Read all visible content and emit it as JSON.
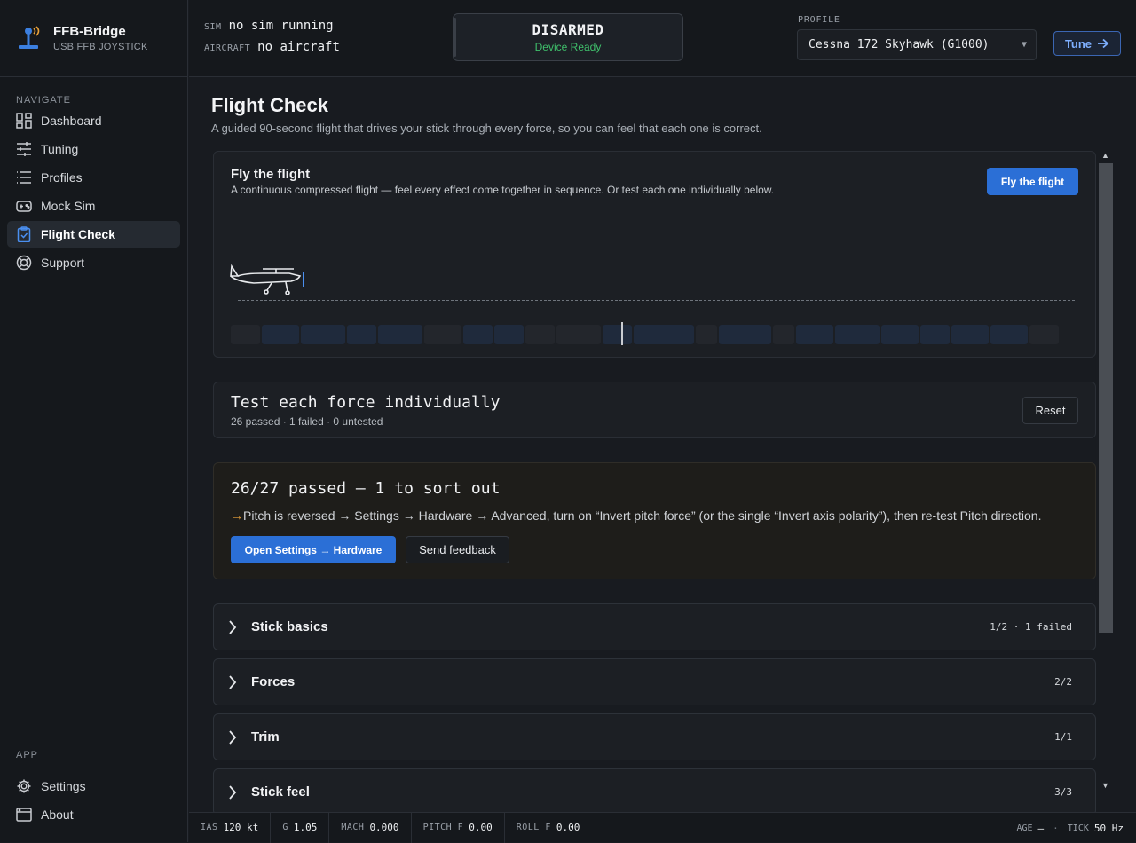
{
  "app": {
    "name": "FFB-Bridge",
    "subtitle": "USB FFB JOYSTICK"
  },
  "nav": {
    "heading": "NAVIGATE",
    "items": [
      {
        "label": "Dashboard",
        "icon": "dashboard-icon"
      },
      {
        "label": "Tuning",
        "icon": "sliders-icon"
      },
      {
        "label": "Profiles",
        "icon": "list-icon"
      },
      {
        "label": "Mock Sim",
        "icon": "gamepad-icon"
      },
      {
        "label": "Flight Check",
        "icon": "clipboard-check-icon",
        "active": true
      },
      {
        "label": "Support",
        "icon": "lifebuoy-icon"
      }
    ],
    "app_heading": "APP",
    "app_items": [
      {
        "label": "Settings",
        "icon": "gear-icon"
      },
      {
        "label": "About",
        "icon": "window-icon"
      }
    ]
  },
  "topbar": {
    "sim_key": "SIM",
    "sim_value": "no sim running",
    "aircraft_key": "AIRCRAFT",
    "aircraft_value": "no aircraft",
    "status": "DISARMED",
    "status_sub": "Device Ready",
    "profile_label": "PROFILE",
    "profile_value": "Cessna 172 Skyhawk (G1000)",
    "tune_label": "Tune"
  },
  "page": {
    "title": "Flight Check",
    "subtitle": "A guided 90-second flight that drives your stick through every force, so you can feel that each one is correct."
  },
  "fly": {
    "title": "Fly the flight",
    "desc": "A continuous compressed flight — feel every effect come together in sequence. Or test each one individually below.",
    "button": "Fly the flight",
    "progress": 0.46,
    "segment_states": [
      "off",
      "on",
      "on",
      "on",
      "on",
      "off",
      "on",
      "on",
      "off",
      "off",
      "on",
      "on",
      "off",
      "on",
      "off",
      "on",
      "on",
      "on",
      "on",
      "on",
      "on",
      "off"
    ]
  },
  "test": {
    "title": "Test each force individually",
    "summary": "26 passed · 1 failed · 0 untested",
    "reset": "Reset"
  },
  "result": {
    "title": "26/27 passed — 1 to sort out",
    "arrow": "→",
    "message": "Pitch is reversed → Settings → Hardware → Advanced, turn on “Invert pitch force” (or the single “Invert axis polarity”), then re-test Pitch direction.",
    "open_button": "Open Settings → Hardware",
    "feedback_button": "Send feedback"
  },
  "groups": [
    {
      "name": "Stick basics",
      "count": "1/2 · 1 failed"
    },
    {
      "name": "Forces",
      "count": "2/2"
    },
    {
      "name": "Trim",
      "count": "1/1"
    },
    {
      "name": "Stick feel",
      "count": "3/3"
    }
  ],
  "statusbar": {
    "ias_key": "IAS",
    "ias": "120 kt",
    "g_key": "G",
    "g": "1.05",
    "mach_key": "MACH",
    "mach": "0.000",
    "pitchf_key": "PITCH F",
    "pitchf": "0.00",
    "rollf_key": "ROLL F",
    "rollf": "0.00",
    "age_key": "AGE",
    "age": "—",
    "sep": "·",
    "tick_key": "TICK",
    "tick": "50 Hz"
  },
  "colors": {
    "accent": "#2b6fd6",
    "ready": "#3fbf6b",
    "warn": "#e8a13a",
    "seg_on": "#1f2a3c",
    "seg_off": "#23262c"
  }
}
